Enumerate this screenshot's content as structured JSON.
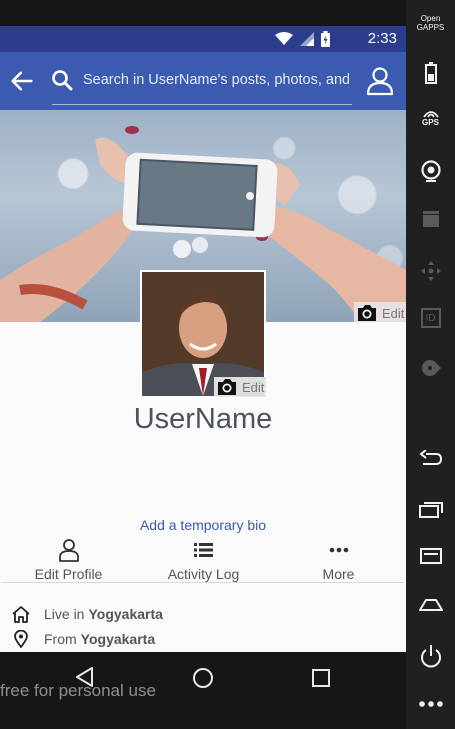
{
  "status_bar": {
    "time": "2:33"
  },
  "app_bar": {
    "search_placeholder": "Search in UserName's posts, photos, and"
  },
  "cover": {
    "edit_label": "Edit"
  },
  "avatar": {
    "edit_label": "Edit"
  },
  "profile": {
    "username": "UserName",
    "bio_link": "Add a temporary bio"
  },
  "actions": [
    {
      "label": "Edit Profile",
      "icon": "person-outline-icon"
    },
    {
      "label": "Activity Log",
      "icon": "list-icon"
    },
    {
      "label": "More",
      "icon": "more-dots-icon"
    }
  ],
  "info": {
    "live_prefix": "Live in",
    "live_value": "Yogyakarta",
    "from_prefix": "From",
    "from_value": "Yogyakarta"
  },
  "watermark": "free for personal use",
  "emulator_toolbar": {
    "logo": "Open GAPPS",
    "gps_label": "GPS",
    "id_label": "ID"
  },
  "colors": {
    "status_bar": "#2d3d8e",
    "app_bar": "#3b5bb0",
    "link": "#3b5bb0"
  }
}
